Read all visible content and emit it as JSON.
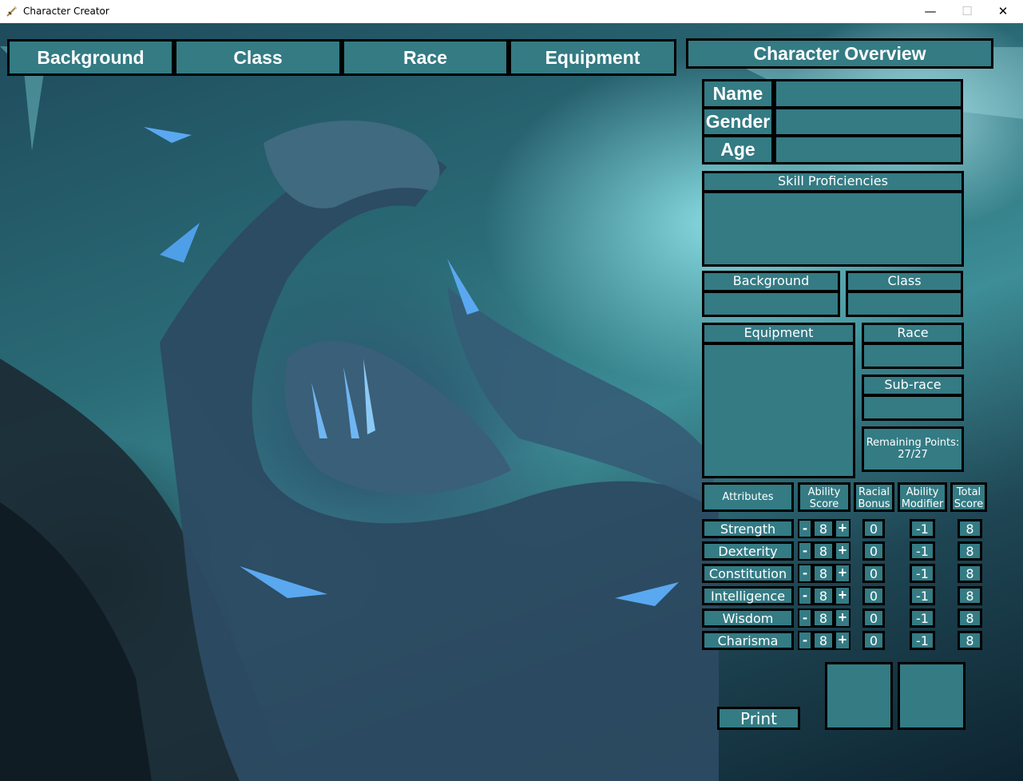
{
  "window": {
    "title": "Character Creator",
    "minimize": "—",
    "maximize": "☐",
    "close": "✕"
  },
  "tabs": [
    "Background",
    "Class",
    "Race",
    "Equipment"
  ],
  "overview": {
    "title": "Character Overview",
    "name_label": "Name",
    "gender_label": "Gender",
    "age_label": "Age",
    "skills_label": "Skill Proficiencies",
    "background_label": "Background",
    "class_label": "Class",
    "equipment_label": "Equipment",
    "race_label": "Race",
    "subrace_label": "Sub-race",
    "remaining_label": "Remaining Points:",
    "remaining_value": "27/27"
  },
  "attributes": {
    "header": "Attributes",
    "col_ability_score": [
      "Ability",
      "Score"
    ],
    "col_racial_bonus": [
      "Racial",
      "Bonus"
    ],
    "col_ability_modifier": [
      "Ability",
      "Modifier"
    ],
    "col_total_score": [
      "Total",
      "Score"
    ],
    "minus": "-",
    "plus": "+",
    "rows": [
      {
        "name": "Strength",
        "score": "8",
        "bonus": "0",
        "modifier": "-1",
        "total": "8"
      },
      {
        "name": "Dexterity",
        "score": "8",
        "bonus": "0",
        "modifier": "-1",
        "total": "8"
      },
      {
        "name": "Constitution",
        "score": "8",
        "bonus": "0",
        "modifier": "-1",
        "total": "8"
      },
      {
        "name": "Intelligence",
        "score": "8",
        "bonus": "0",
        "modifier": "-1",
        "total": "8"
      },
      {
        "name": "Wisdom",
        "score": "8",
        "bonus": "0",
        "modifier": "-1",
        "total": "8"
      },
      {
        "name": "Charisma",
        "score": "8",
        "bonus": "0",
        "modifier": "-1",
        "total": "8"
      }
    ]
  },
  "print_label": "Print",
  "colors": {
    "panel": "#347b84",
    "border": "#000000",
    "text": "#ffffff"
  },
  "icons": {
    "app": "sword-icon",
    "background": "dragon-artwork"
  }
}
